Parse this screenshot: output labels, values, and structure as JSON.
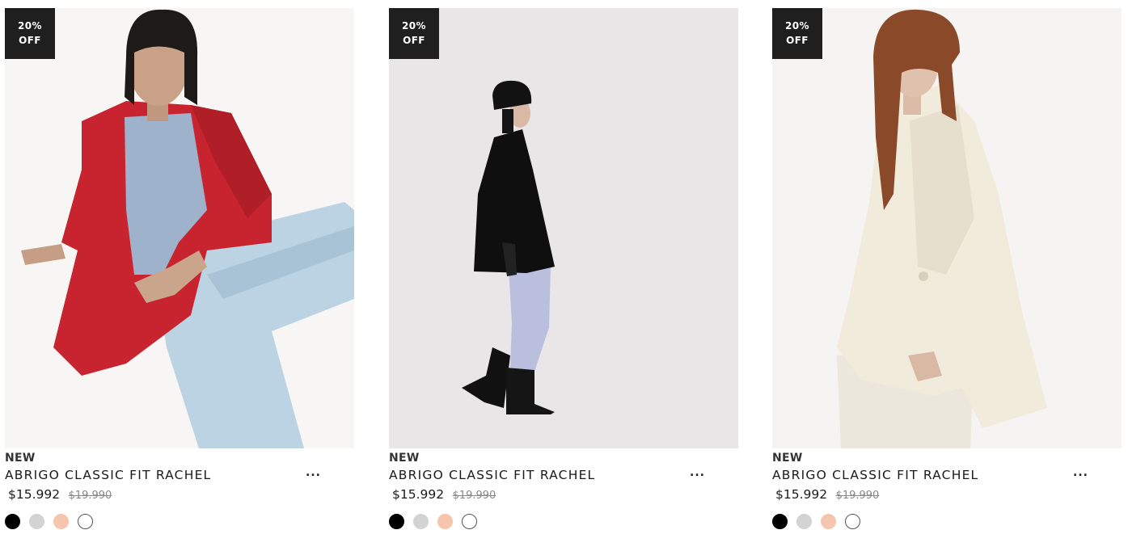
{
  "products": [
    {
      "badge": {
        "line1": "20%",
        "line2": "OFF"
      },
      "tag": "NEW",
      "title": "ABRIGO CLASSIC FIT RACHEL",
      "more": "...",
      "price": "$15.992",
      "old_price": "$19.990",
      "photo_icon": "model-red-coat-photo"
    },
    {
      "badge": {
        "line1": "20%",
        "line2": "OFF"
      },
      "tag": "NEW",
      "title": "ABRIGO CLASSIC FIT RACHEL",
      "more": "...",
      "price": "$15.992",
      "old_price": "$19.990",
      "photo_icon": "model-black-coat-photo"
    },
    {
      "badge": {
        "line1": "20%",
        "line2": "OFF"
      },
      "tag": "NEW",
      "title": "ABRIGO CLASSIC FIT RACHEL",
      "more": "...",
      "price": "$15.992",
      "old_price": "$19.990",
      "photo_icon": "model-cream-coat-photo"
    }
  ],
  "swatch_colors": [
    "#000000",
    "#d3d3d3",
    "#f5c6ad",
    "#ffffff"
  ],
  "colors": {
    "badge_bg": "#1f1f1f",
    "text": "#1a1a1a",
    "old_price": "#888888"
  }
}
